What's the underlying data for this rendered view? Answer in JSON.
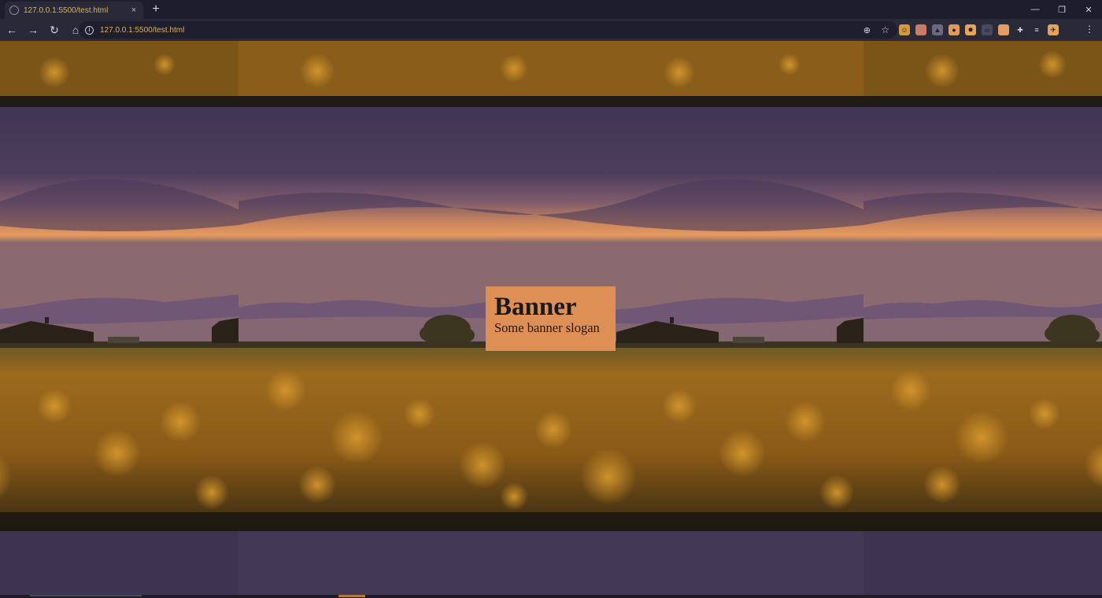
{
  "browser": {
    "tab_title": "127.0.0.1:5500/test.html",
    "tab_close": "×",
    "new_tab": "+",
    "window": {
      "minimize": "—",
      "restore": "❐",
      "close": "✕"
    },
    "nav": {
      "back": "←",
      "forward": "→",
      "reload": "↻",
      "home": "⌂"
    },
    "address": "127.0.0.1:5500/test.html",
    "info_glyph": "i",
    "zoom_glyph": "⊕",
    "star_glyph": "☆",
    "menu_glyph": "⋮",
    "extensions": [
      {
        "name": "face-extension-icon",
        "color": "#d49a3d",
        "glyph": "☺"
      },
      {
        "name": "square-extension-icon",
        "color": "#c97b66",
        "glyph": ""
      },
      {
        "name": "triangle-extension-icon",
        "color": "#6b6880",
        "glyph": "▲"
      },
      {
        "name": "magnifier-extension-icon",
        "color": "#e29a59",
        "glyph": "●"
      },
      {
        "name": "gear-extension-icon",
        "color": "#e6a55c",
        "glyph": "✸"
      },
      {
        "name": "grey-extension-icon",
        "color": "#4a4860",
        "glyph": "∞"
      },
      {
        "name": "orange-extension-icon",
        "color": "#e39c62",
        "glyph": ""
      },
      {
        "name": "puzzle-icon",
        "color": "#d6d3e6",
        "glyph": "✚"
      },
      {
        "name": "reading-list-icon",
        "color": "#d6d3e6",
        "glyph": "≡"
      },
      {
        "name": "avatar",
        "color": "#e3a35f",
        "glyph": "✈"
      }
    ]
  },
  "page": {
    "banner": {
      "title": "Banner",
      "slogan": "Some banner slogan"
    }
  },
  "colors": {
    "sky_top": "#3f3554",
    "sky_horizon": "#e69a5e",
    "field": "#9c6a1e",
    "banner_bg": "#de8f55"
  }
}
